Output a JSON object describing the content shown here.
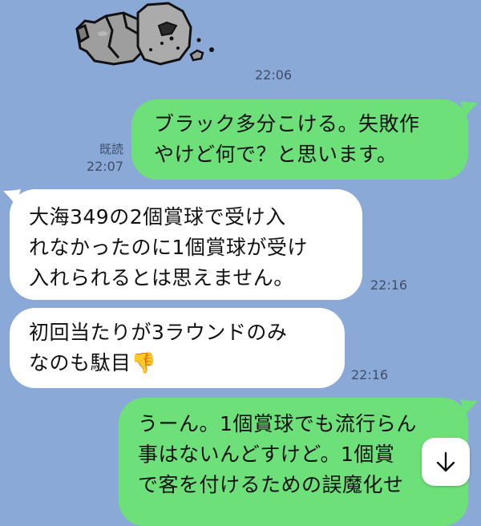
{
  "chat": {
    "sticker": {
      "name": "rock-character-sticker",
      "time": "22:06"
    },
    "messages": [
      {
        "side": "out",
        "lines": [
          "ブラック多分こける。失敗作",
          "やけど何で？と思います。"
        ],
        "read": "既読",
        "time": "22:07"
      },
      {
        "side": "in",
        "lines": [
          "大海349の2個賞球で受け入",
          "れなかったのに1個賞球が受け",
          "入れられるとは思えません。"
        ],
        "time": "22:16"
      },
      {
        "side": "in",
        "lines": [
          "初回当たりが3ラウンドのみ",
          "なのも駄目👎"
        ],
        "time": "22:16"
      },
      {
        "side": "out",
        "lines": [
          "うーん。1個賞球でも流行らん",
          "事はないんどすけど。1個賞",
          "で客を付けるための誤魔化せ"
        ]
      }
    ]
  },
  "ui": {
    "scroll_down_icon": "arrow-down-icon",
    "colors": {
      "background": "#8aa9d6",
      "outgoing": "#6ee07a",
      "incoming": "#ffffff"
    }
  }
}
